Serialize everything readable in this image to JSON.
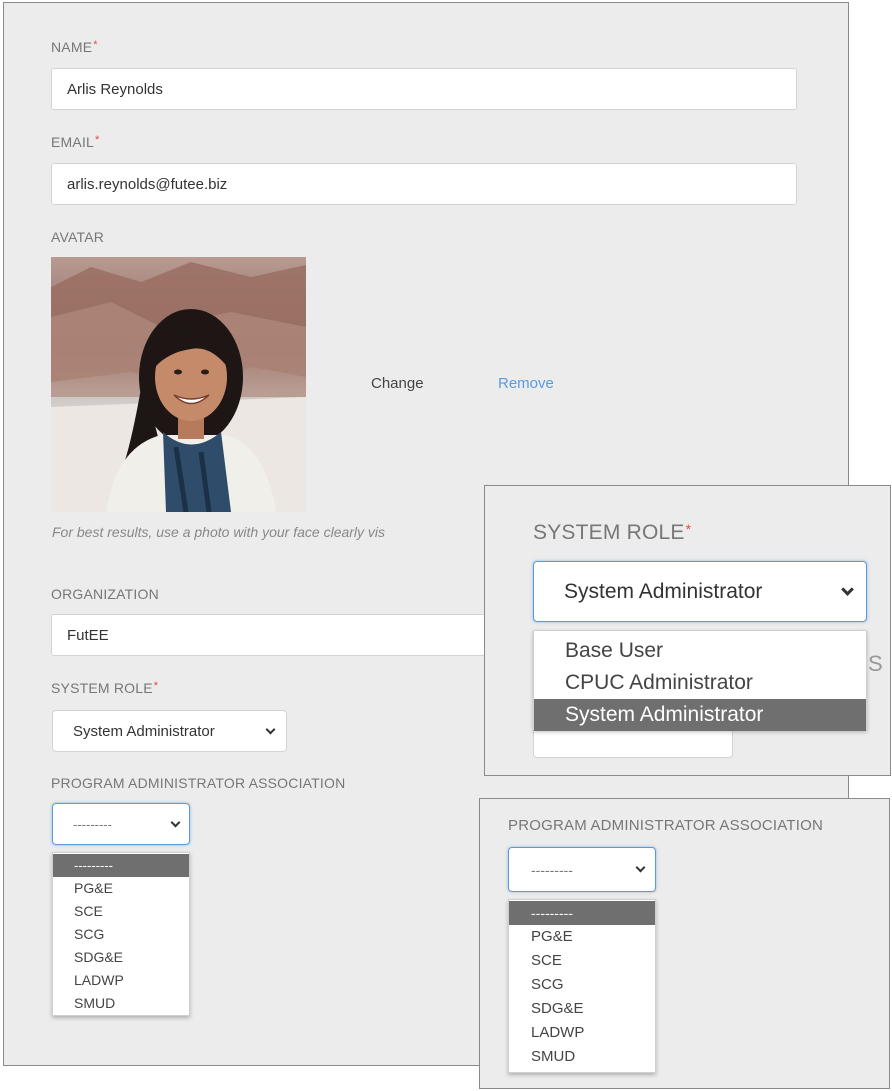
{
  "form": {
    "name": {
      "label": "NAME",
      "required_mark": "*",
      "value": "Arlis Reynolds"
    },
    "email": {
      "label": "EMAIL",
      "required_mark": "*",
      "value": "arlis.reynolds@futee.biz"
    },
    "avatar": {
      "label": "AVATAR",
      "change_label": "Change",
      "remove_label": "Remove",
      "hint": "For best results, use a photo with your face clearly vis"
    },
    "organization": {
      "label": "ORGANIZATION",
      "value": "FutEE"
    },
    "system_role": {
      "label": "SYSTEM ROLE",
      "required_mark": "*",
      "selected": "System Administrator"
    },
    "program_admin": {
      "label": "PROGRAM ADMINISTRATOR ASSOCIATION",
      "selected": "---------",
      "options": [
        "---------",
        "PG&E",
        "SCE",
        "SCG",
        "SDG&E",
        "LADWP",
        "SMUD"
      ]
    }
  },
  "zoom_role": {
    "label": "SYSTEM ROLE",
    "required_mark": "*",
    "selected": "System Administrator",
    "options": [
      "Base User",
      "CPUC Administrator",
      "System Administrator"
    ],
    "peek_text": "S"
  },
  "zoom_program": {
    "label": "PROGRAM ADMINISTRATOR ASSOCIATION",
    "selected": "---------",
    "options": [
      "---------",
      "PG&E",
      "SCE",
      "SCG",
      "SDG&E",
      "LADWP",
      "SMUD"
    ]
  },
  "colors": {
    "panel_bg": "#ececec",
    "required": "#e84a3c",
    "link": "#5a9be0",
    "selected_option": "#6f6f6f",
    "focus_border": "#5b9bd5"
  }
}
